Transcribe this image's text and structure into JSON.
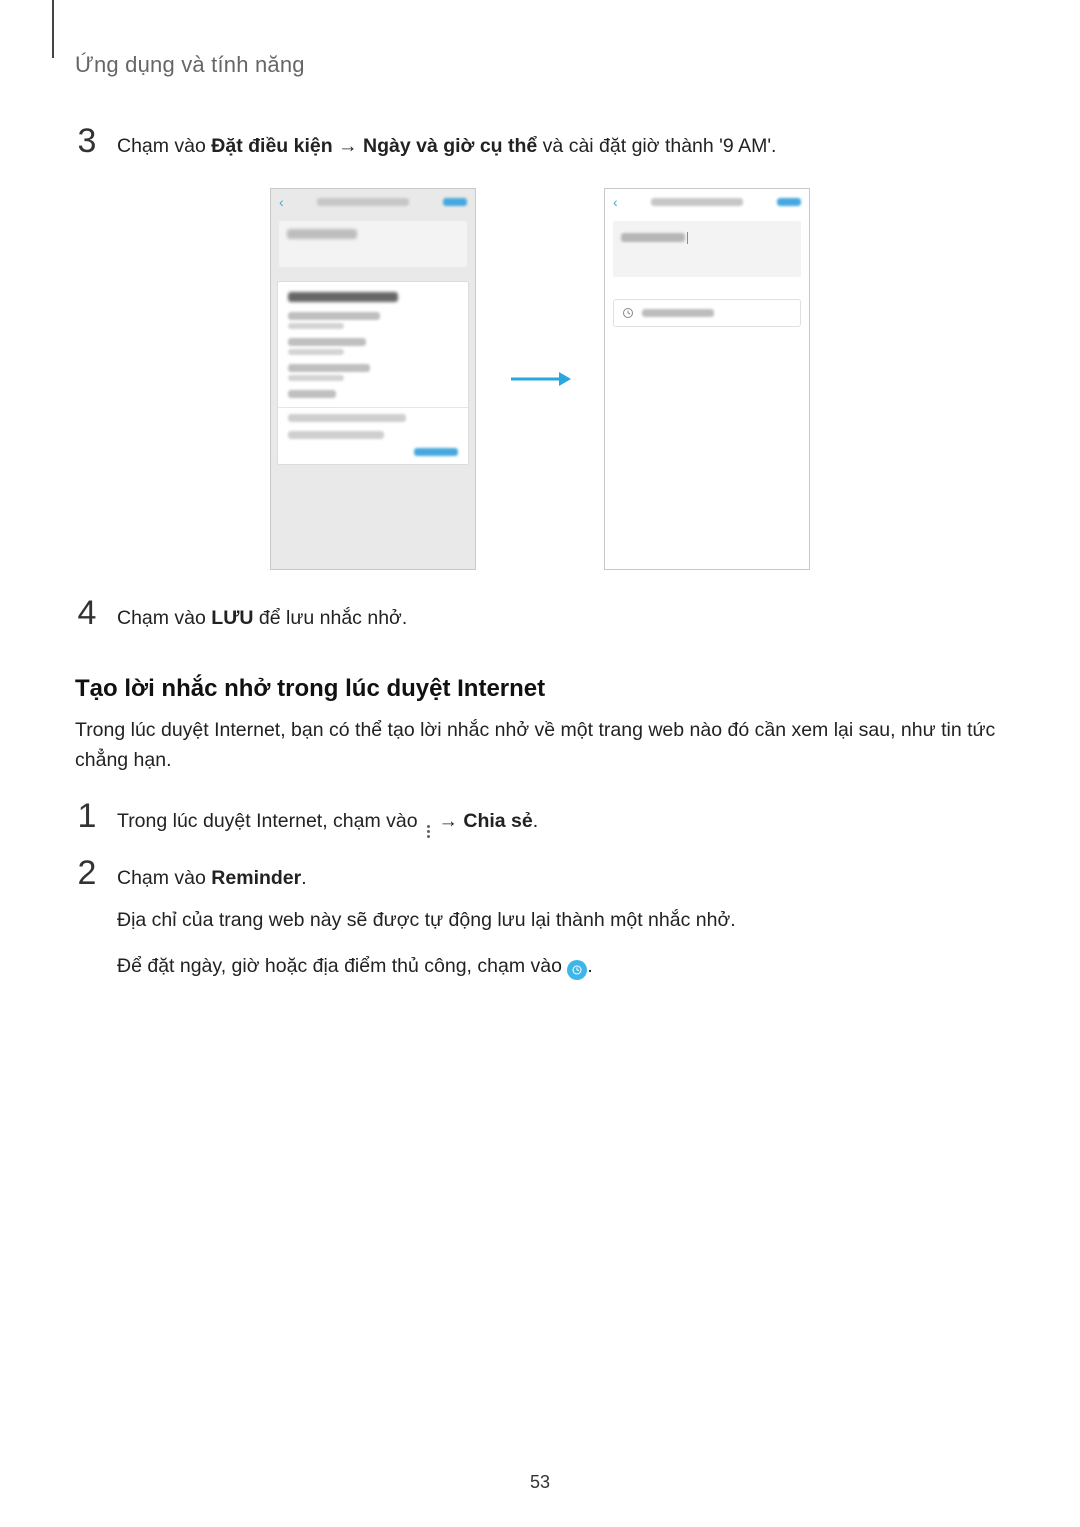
{
  "header": {
    "section_title": "Ứng dụng và tính năng"
  },
  "step3": {
    "num": "3",
    "pre": "Chạm vào ",
    "bold1": "Đặt điều kiện",
    "arrow": " → ",
    "bold2": "Ngày và giờ cụ thể",
    "post": " và cài đặt giờ thành '9 AM'."
  },
  "step4": {
    "num": "4",
    "pre": "Chạm vào ",
    "bold": "LƯU",
    "post": " để lưu nhắc nhở."
  },
  "section2": {
    "heading": "Tạo lời nhắc nhở trong lúc duyệt Internet",
    "intro": "Trong lúc duyệt Internet, bạn có thể tạo lời nhắc nhở về một trang web nào đó cần xem lại sau, như tin tức chẳng hạn."
  },
  "s2_step1": {
    "num": "1",
    "pre": "Trong lúc duyệt Internet, chạm vào ",
    "arrow": " → ",
    "bold": "Chia sẻ",
    "post": "."
  },
  "s2_step2": {
    "num": "2",
    "line1_pre": "Chạm vào ",
    "line1_bold": "Reminder",
    "line1_post": ".",
    "line2": "Địa chỉ của trang web này sẽ được tự động lưu lại thành một nhắc nhở.",
    "line3_pre": "Để đặt ngày, giờ hoặc địa điểm thủ công, chạm vào ",
    "line3_post": "."
  },
  "page_number": "53",
  "icons": {
    "more": "more-vert-icon",
    "clock_badge": "clock-badge-icon",
    "arrow_right": "arrow-right-icon",
    "chevron_left": "chevron-left-icon",
    "clock_small": "clock-icon"
  }
}
